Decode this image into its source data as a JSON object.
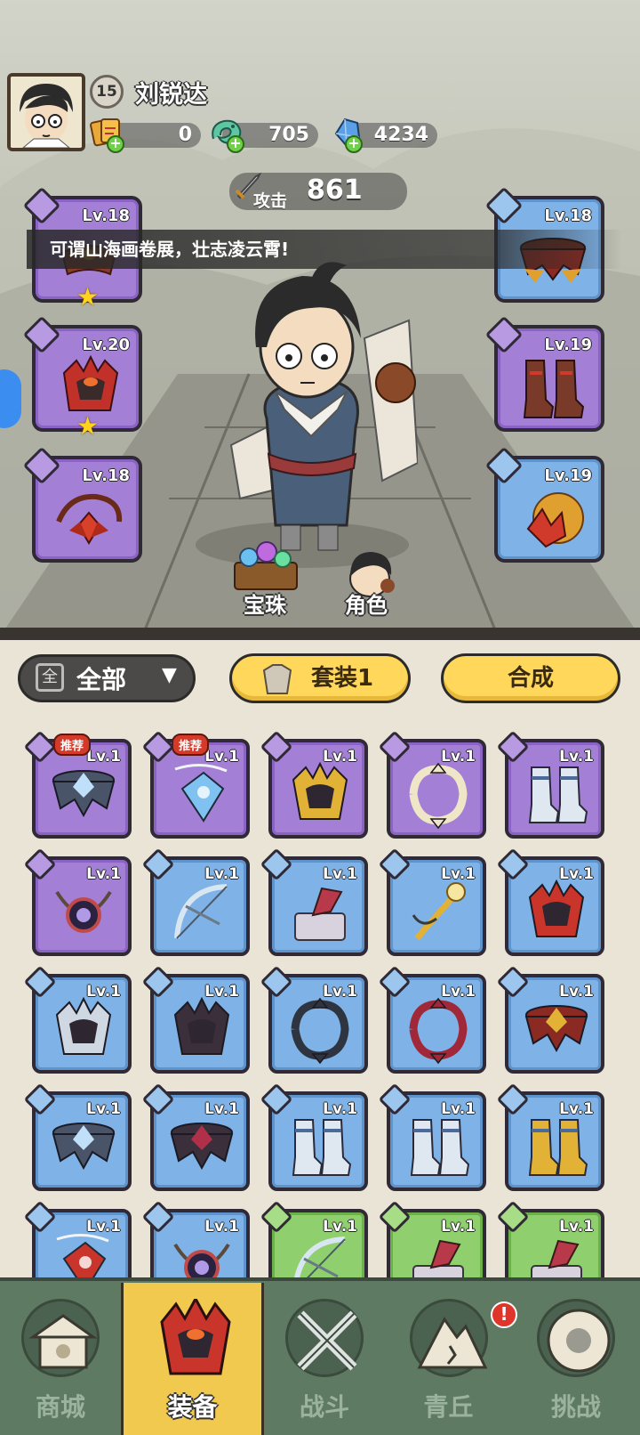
{
  "player": {
    "name": "刘锐达",
    "level": "15"
  },
  "currencies": [
    {
      "icon": "gold-tickets-icon",
      "value": "0"
    },
    {
      "icon": "jade-dragon-icon",
      "value": "705"
    },
    {
      "icon": "blue-crystal-icon",
      "value": "4234"
    }
  ],
  "attack": {
    "label": "攻击",
    "value": "861"
  },
  "banner": "可谓山海画卷展，壮志凌云霄!",
  "equipped": {
    "left": [
      {
        "level": "Lv.18",
        "rarity": "purple",
        "icon": "belt-icon",
        "slot_icon": "sword-slot-icon",
        "starred": true
      },
      {
        "level": "Lv.20",
        "rarity": "purple",
        "icon": "helmet-icon",
        "slot_icon": "armor-slot-icon",
        "starred": true
      },
      {
        "level": "Lv.18",
        "rarity": "purple",
        "icon": "amulet-icon",
        "slot_icon": "ring-slot-icon",
        "starred": false
      }
    ],
    "right": [
      {
        "level": "Lv.18",
        "rarity": "blue",
        "icon": "belt-icon",
        "slot_icon": "belt-slot-icon"
      },
      {
        "level": "Lv.19",
        "rarity": "purple",
        "icon": "boots-icon",
        "slot_icon": "boots-slot-icon"
      },
      {
        "level": "Lv.19",
        "rarity": "blue",
        "icon": "pendant-icon",
        "slot_icon": "pendant-slot-icon"
      }
    ]
  },
  "scene_buttons": {
    "gems": "宝珠",
    "character": "角色"
  },
  "filter": {
    "dropdown_label": "全部",
    "dropdown_icon_text": "全",
    "set_button": "套装1",
    "craft_button": "合成"
  },
  "recommend_label": "推荐",
  "inventory": [
    {
      "level": "Lv.1",
      "rarity": "purple",
      "icon": "frost-belt-icon",
      "recommended": true
    },
    {
      "level": "Lv.1",
      "rarity": "purple",
      "icon": "ice-pendant-icon",
      "recommended": true
    },
    {
      "level": "Lv.1",
      "rarity": "purple",
      "icon": "gold-armor-icon",
      "recommended": false
    },
    {
      "level": "Lv.1",
      "rarity": "purple",
      "icon": "feather-ring-icon",
      "recommended": false
    },
    {
      "level": "Lv.1",
      "rarity": "purple",
      "icon": "frost-boots-icon",
      "recommended": false
    },
    {
      "level": "Lv.1",
      "rarity": "purple",
      "icon": "orb-necklace-icon",
      "recommended": false
    },
    {
      "level": "Lv.1",
      "rarity": "blue",
      "icon": "bow-icon",
      "recommended": false
    },
    {
      "level": "Lv.1",
      "rarity": "blue",
      "icon": "axe-block-icon",
      "recommended": false
    },
    {
      "level": "Lv.1",
      "rarity": "blue",
      "icon": "golden-staff-icon",
      "recommended": false
    },
    {
      "level": "Lv.1",
      "rarity": "blue",
      "icon": "red-helmet-icon",
      "recommended": false
    },
    {
      "level": "Lv.1",
      "rarity": "blue",
      "icon": "ice-armor-icon",
      "recommended": false
    },
    {
      "level": "Lv.1",
      "rarity": "blue",
      "icon": "dark-armor-icon",
      "recommended": false
    },
    {
      "level": "Lv.1",
      "rarity": "blue",
      "icon": "dark-ring-icon",
      "recommended": false
    },
    {
      "level": "Lv.1",
      "rarity": "blue",
      "icon": "crimson-ring-icon",
      "recommended": false
    },
    {
      "level": "Lv.1",
      "rarity": "blue",
      "icon": "lotus-belt-icon",
      "recommended": false
    },
    {
      "level": "Lv.1",
      "rarity": "blue",
      "icon": "frost-belt-icon",
      "recommended": false
    },
    {
      "level": "Lv.1",
      "rarity": "blue",
      "icon": "dark-belt-icon",
      "recommended": false
    },
    {
      "level": "Lv.1",
      "rarity": "blue",
      "icon": "frost-boots-icon",
      "recommended": false
    },
    {
      "level": "Lv.1",
      "rarity": "blue",
      "icon": "frost-boots-icon",
      "recommended": false
    },
    {
      "level": "Lv.1",
      "rarity": "blue",
      "icon": "gold-boots-icon",
      "recommended": false
    },
    {
      "level": "Lv.1",
      "rarity": "blue",
      "icon": "fire-pendant-icon",
      "recommended": false
    },
    {
      "level": "Lv.1",
      "rarity": "blue",
      "icon": "orb-necklace-icon",
      "recommended": false
    },
    {
      "level": "Lv.1",
      "rarity": "green",
      "icon": "bow-icon",
      "recommended": false
    },
    {
      "level": "Lv.1",
      "rarity": "green",
      "icon": "axe-block-icon",
      "recommended": false
    },
    {
      "level": "Lv.1",
      "rarity": "green",
      "icon": "axe-block-icon",
      "recommended": false
    }
  ],
  "nav": [
    {
      "label": "商城",
      "icon": "shop-pavilion-icon",
      "active": false
    },
    {
      "label": "装备",
      "icon": "red-helmet-icon",
      "active": true
    },
    {
      "label": "战斗",
      "icon": "crossed-swords-icon",
      "active": false
    },
    {
      "label": "青丘",
      "icon": "mountain-icon",
      "active": false,
      "alert": "!"
    },
    {
      "label": "挑战",
      "icon": "challenge-disc-icon",
      "active": false
    }
  ],
  "colors": {
    "purple": "#a47fd6",
    "blue": "#7fb2e6",
    "green": "#8fcf6e",
    "accent": "#ffd75a",
    "nav_bg": "#5f7a62"
  }
}
